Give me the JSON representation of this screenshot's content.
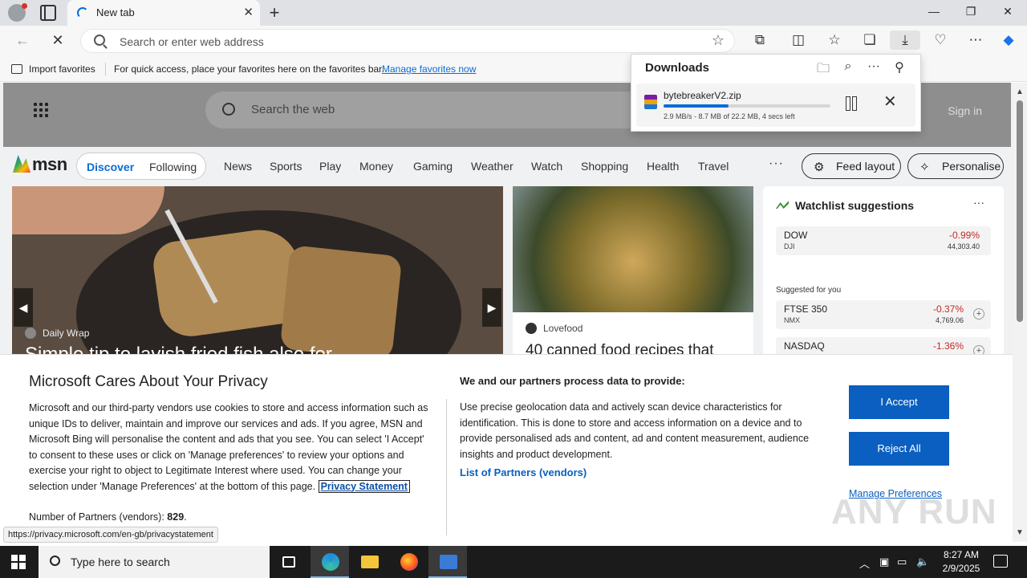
{
  "browser": {
    "tab_title": "New tab",
    "address_placeholder": "Search or enter web address",
    "favorites_bar": {
      "import_label": "Import favorites",
      "info_text": "For quick access, place your favorites here on the favorites bar.",
      "manage_link": "Manage favorites now"
    },
    "status_url": "https://privacy.microsoft.com/en-gb/privacystatement"
  },
  "downloads": {
    "title": "Downloads",
    "item": {
      "filename": "bytebreakerV2.zip",
      "status": "2.9 MB/s - 8.7 MB of 22.2 MB, 4 secs left",
      "progress_percent": 39
    }
  },
  "msn": {
    "search_placeholder": "Search the web",
    "sign_in": "Sign in",
    "logo_text": "msn",
    "nav": {
      "discover": "Discover",
      "following": "Following",
      "categories": [
        "News",
        "Sports",
        "Play",
        "Money",
        "Gaming",
        "Weather",
        "Watch",
        "Shopping",
        "Health",
        "Travel"
      ],
      "more": "···",
      "feed_layout": "Feed layout",
      "personalise": "Personalise"
    },
    "card1": {
      "source": "Daily Wrap",
      "headline": "Simple tip to lavish fried fish also for..."
    },
    "card2": {
      "source": "Lovefood",
      "headline": "40 canned food recipes that"
    },
    "watchlist": {
      "title": "Watchlist suggestions",
      "suggested_label": "Suggested for you",
      "stocks": [
        {
          "name": "DOW",
          "symbol": "DJI",
          "change": "-0.99%",
          "value": "44,303.40"
        },
        {
          "name": "FTSE 350",
          "symbol": "NMX",
          "change": "-0.37%",
          "value": "4,769.06"
        },
        {
          "name": "NASDAQ",
          "symbol": "",
          "change": "-1.36%",
          "value": ""
        }
      ]
    }
  },
  "privacy": {
    "title": "Microsoft Cares About Your Privacy",
    "body": "Microsoft and our third-party vendors use cookies to store and access information such as unique IDs to deliver, maintain and improve our services and ads. If you agree, MSN and Microsoft Bing will personalise the content and ads that you see. You can select 'I Accept' to consent to these uses or click on 'Manage preferences' to review your options and exercise your right to object to Legitimate Interest where used.  You can change your selection under 'Manage Preferences' at the bottom of this page.",
    "privacy_statement": "Privacy Statement",
    "partners_label": "Number of Partners (vendors):",
    "partners_count": "829",
    "heading2": "We and our partners process data to provide:",
    "body2": "Use precise geolocation data and actively scan device characteristics for identification. This is done to store and access information on a device and to provide personalised ads and content, ad and content measurement, audience insights and product development.",
    "list_link": "List of Partners (vendors)",
    "accept": "I Accept",
    "reject": "Reject All",
    "manage": "Manage Preferences"
  },
  "watermark": "ANY RUN",
  "taskbar": {
    "search_placeholder": "Type here to search",
    "time": "8:27 AM",
    "date": "2/9/2025"
  }
}
